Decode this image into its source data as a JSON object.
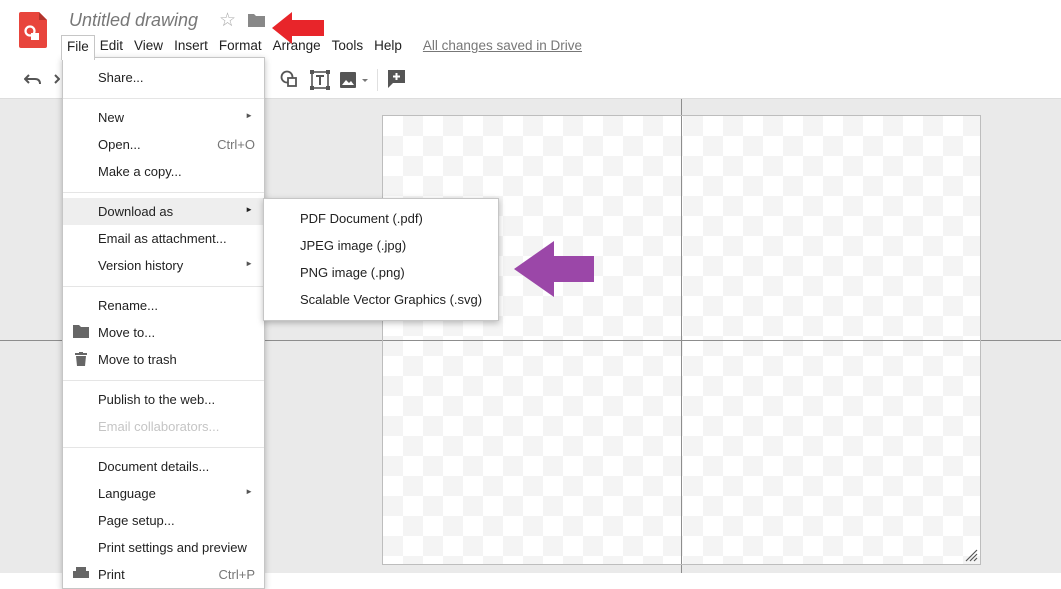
{
  "document": {
    "title": "Untitled drawing",
    "saved_status": "All changes saved in Drive"
  },
  "menubar": [
    "File",
    "Edit",
    "View",
    "Insert",
    "Format",
    "Arrange",
    "Tools",
    "Help"
  ],
  "file_menu": {
    "share": "Share...",
    "new": "New",
    "open": "Open...",
    "open_shortcut": "Ctrl+O",
    "make_copy": "Make a copy...",
    "download_as": "Download as",
    "email_attachment": "Email as attachment...",
    "version_history": "Version history",
    "rename": "Rename...",
    "move_to": "Move to...",
    "move_to_trash": "Move to trash",
    "publish": "Publish to the web...",
    "email_collaborators": "Email collaborators...",
    "document_details": "Document details...",
    "language": "Language",
    "page_setup": "Page setup...",
    "print_settings": "Print settings and preview",
    "print": "Print",
    "print_shortcut": "Ctrl+P"
  },
  "download_submenu": [
    "PDF Document (.pdf)",
    "JPEG image (.jpg)",
    "PNG image (.png)",
    "Scalable Vector Graphics (.svg)"
  ],
  "colors": {
    "app_red": "#e8453c",
    "annotation_red": "#e8252a",
    "annotation_purple": "#9b47a8",
    "menu_highlight": "#eeeeee"
  },
  "icons": [
    "drawings-logo-icon",
    "star-icon",
    "folder-icon",
    "undo-icon",
    "redo-icon",
    "shape-icon",
    "text-box-icon",
    "image-icon",
    "add-comment-icon",
    "folder-icon",
    "trash-icon",
    "printer-icon",
    "submenu-arrow-icon",
    "resize-handle-icon"
  ]
}
